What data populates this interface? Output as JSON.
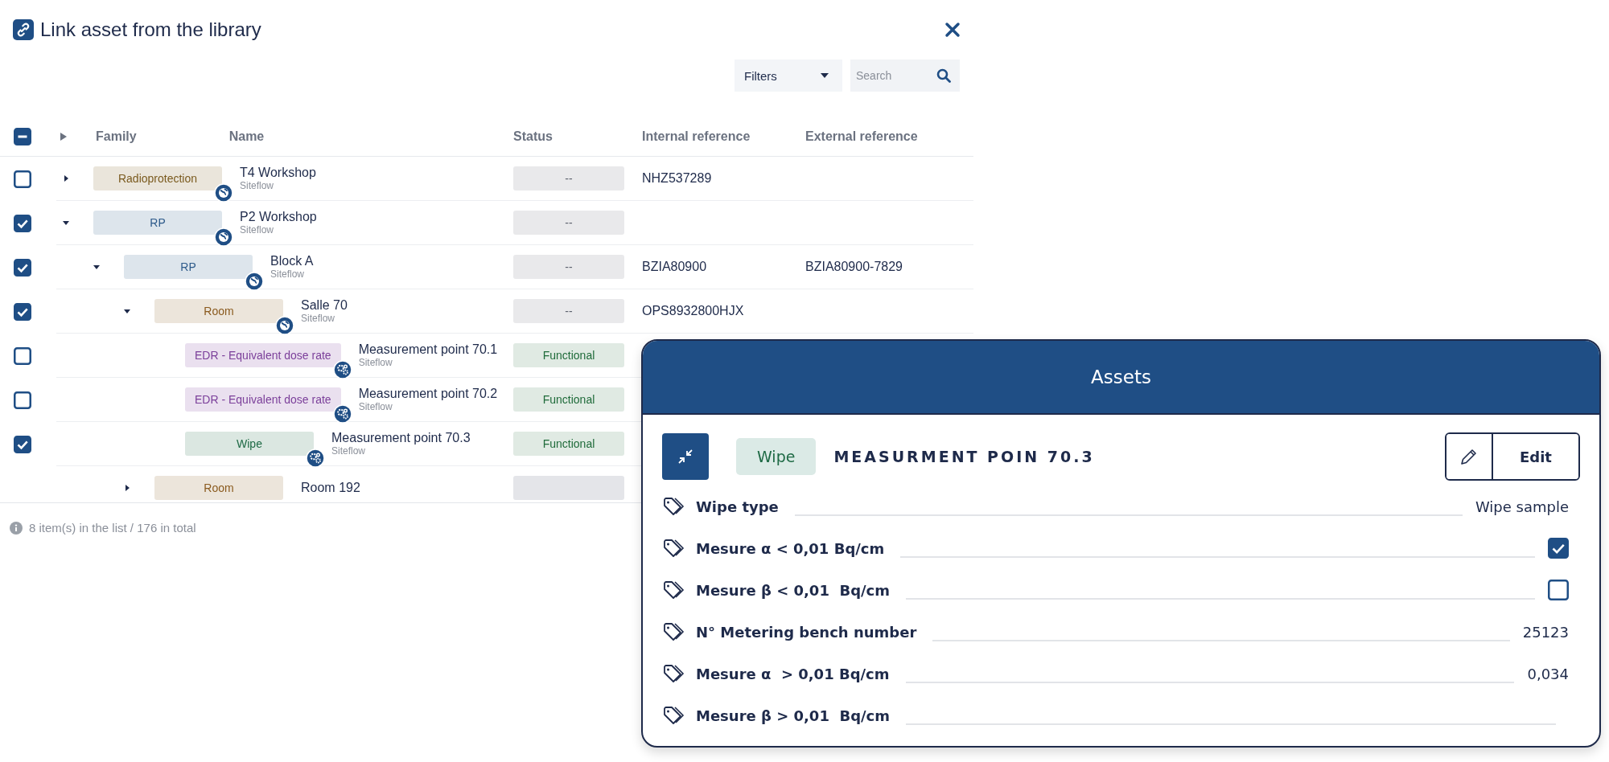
{
  "dialog": {
    "title": "Link asset from the library",
    "filters": {
      "label": "Filters"
    },
    "search": {
      "placeholder": "Search"
    }
  },
  "table": {
    "header_checkbox": {
      "indeterminate": true
    },
    "columns": [
      "Family",
      "Name",
      "Status",
      "Internal reference",
      "External reference"
    ],
    "rows": [
      {
        "checked": false,
        "expanded": false,
        "family": {
          "label": "Radioprotection",
          "color": "#7a5a1e"
        },
        "kind": "location",
        "name": "T4 Workshop",
        "source": "Siteflow",
        "status": {
          "label": "--",
          "color": "#5f6470"
        },
        "internal_reference": "NHZ537289"
      },
      {
        "checked": true,
        "expanded": true,
        "family": {
          "label": "RP",
          "color": "#2d5a8a"
        },
        "kind": "location",
        "name": "P2 Workshop",
        "source": "Siteflow",
        "status": {
          "label": "--",
          "color": "#5f6470"
        },
        "children": [
          {
            "checked": true,
            "expanded": true,
            "family": {
              "label": "RP",
              "color": "#2d5a8a"
            },
            "kind": "location",
            "name": "Block A",
            "source": "Siteflow",
            "status": {
              "label": "--",
              "color": "#5f6470"
            },
            "internal_reference": "BZIA80900",
            "external_reference": "BZIA80900-7829",
            "children": [
              {
                "checked": true,
                "expanded": true,
                "family": {
                  "label": "Room",
                  "color": "#8a5a1e"
                },
                "kind": "location",
                "name": "Salle 70",
                "source": "Siteflow",
                "status": {
                  "label": "--",
                  "color": "#5f6470"
                },
                "internal_reference": "OPS8932800HJX",
                "children": [
                  {
                    "checked": false,
                    "family": {
                      "label": "EDR - Equivalent dose rate",
                      "color": "#7b3f9a"
                    },
                    "kind": "equipment",
                    "name": "Measurement point 70.1",
                    "source": "Siteflow",
                    "status": {
                      "label": "Functional",
                      "color": "#1f6b3a"
                    }
                  },
                  {
                    "checked": false,
                    "family": {
                      "label": "EDR - Equivalent dose rate",
                      "color": "#7b3f9a"
                    },
                    "kind": "equipment",
                    "name": "Measurement point 70.2",
                    "source": "Siteflow",
                    "status": {
                      "label": "Functional",
                      "color": "#1f6b3a"
                    }
                  },
                  {
                    "checked": true,
                    "family": {
                      "label": "Wipe",
                      "color": "#1e6a45"
                    },
                    "kind": "equipment",
                    "name": "Measurement point 70.3",
                    "source": "Siteflow",
                    "status": {
                      "label": "Functional",
                      "color": "#1f6b3a"
                    }
                  }
                ]
              },
              {
                "expanded": false,
                "family": {
                  "label": "Room",
                  "color": "#8a5a1e"
                },
                "name": "Room 192"
              }
            ]
          }
        ]
      }
    ]
  },
  "footer": {
    "summary": "8 item(s) in the list / 176 in total"
  },
  "panel": {
    "title": "Assets",
    "tag": "Wipe",
    "heading": "MEASURMENT POIN 70.3",
    "edit_label": "Edit",
    "fields": [
      {
        "kind": "text",
        "label": "Wipe type",
        "value": "Wipe sample"
      },
      {
        "kind": "checkbox",
        "label": "Mesure α < 0,01 Bq/cm",
        "checked": true
      },
      {
        "kind": "checkbox",
        "label": "Mesure β < 0,01  Bq/cm",
        "checked": false
      },
      {
        "kind": "text",
        "label": "N° Metering bench number",
        "value": "25123"
      },
      {
        "kind": "text",
        "label": "Mesure α  > 0,01 Bq/cm",
        "value": "0,034"
      },
      {
        "kind": "text",
        "label": "Mesure β > 0,01  Bq/cm"
      }
    ]
  }
}
